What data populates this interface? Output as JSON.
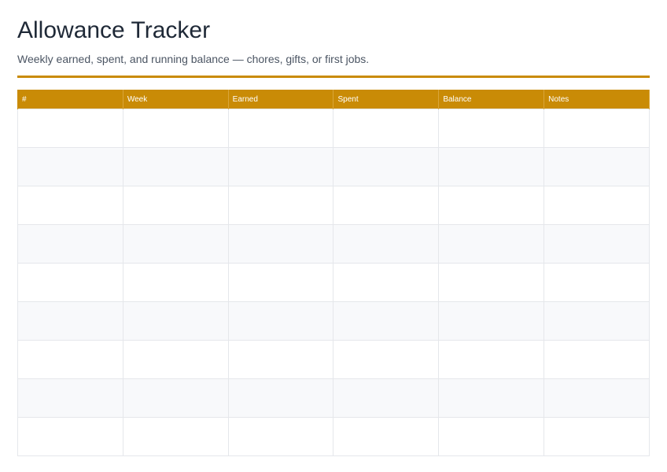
{
  "header": {
    "title": "Allowance Tracker",
    "subtitle": "Weekly earned, spent, and running balance — chores, gifts, or first jobs."
  },
  "table": {
    "columns": [
      "#",
      "Week",
      "Earned",
      "Spent",
      "Balance",
      "Notes"
    ],
    "rows": [
      [
        "",
        "",
        "",
        "",
        "",
        ""
      ],
      [
        "",
        "",
        "",
        "",
        "",
        ""
      ],
      [
        "",
        "",
        "",
        "",
        "",
        ""
      ],
      [
        "",
        "",
        "",
        "",
        "",
        ""
      ],
      [
        "",
        "",
        "",
        "",
        "",
        ""
      ],
      [
        "",
        "",
        "",
        "",
        "",
        ""
      ],
      [
        "",
        "",
        "",
        "",
        "",
        ""
      ],
      [
        "",
        "",
        "",
        "",
        "",
        ""
      ],
      [
        "",
        "",
        "",
        "",
        "",
        ""
      ]
    ]
  },
  "colors": {
    "accent": "#c98b06",
    "row_alt": "#f8f9fb",
    "grid": "#e5e7eb"
  }
}
